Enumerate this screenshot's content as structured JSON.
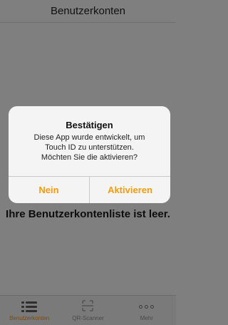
{
  "navbar": {
    "title": "Benutzerkonten"
  },
  "main": {
    "empty_message": "Ihre Benutzerkontenliste ist leer."
  },
  "dialog": {
    "title": "Bestätigen",
    "message_line1": "Diese App wurde entwickelt, um",
    "message_line2": "Touch ID zu unterstützen.",
    "message_line3": "Möchten Sie die aktivieren?",
    "buttons": {
      "cancel": "Nein",
      "confirm": "Aktivieren"
    }
  },
  "tabbar": {
    "tabs": [
      {
        "label": "Benutzerkonten",
        "icon": "list-icon",
        "active": true
      },
      {
        "label": "QR-Scanner",
        "icon": "qr-scanner-icon",
        "active": false
      },
      {
        "label": "Mehr",
        "icon": "more-icon",
        "active": false
      }
    ]
  },
  "colors": {
    "accent": "#f39c12",
    "overlay": "#7f7f7f",
    "dialog_bg": "#f4f4f4"
  }
}
